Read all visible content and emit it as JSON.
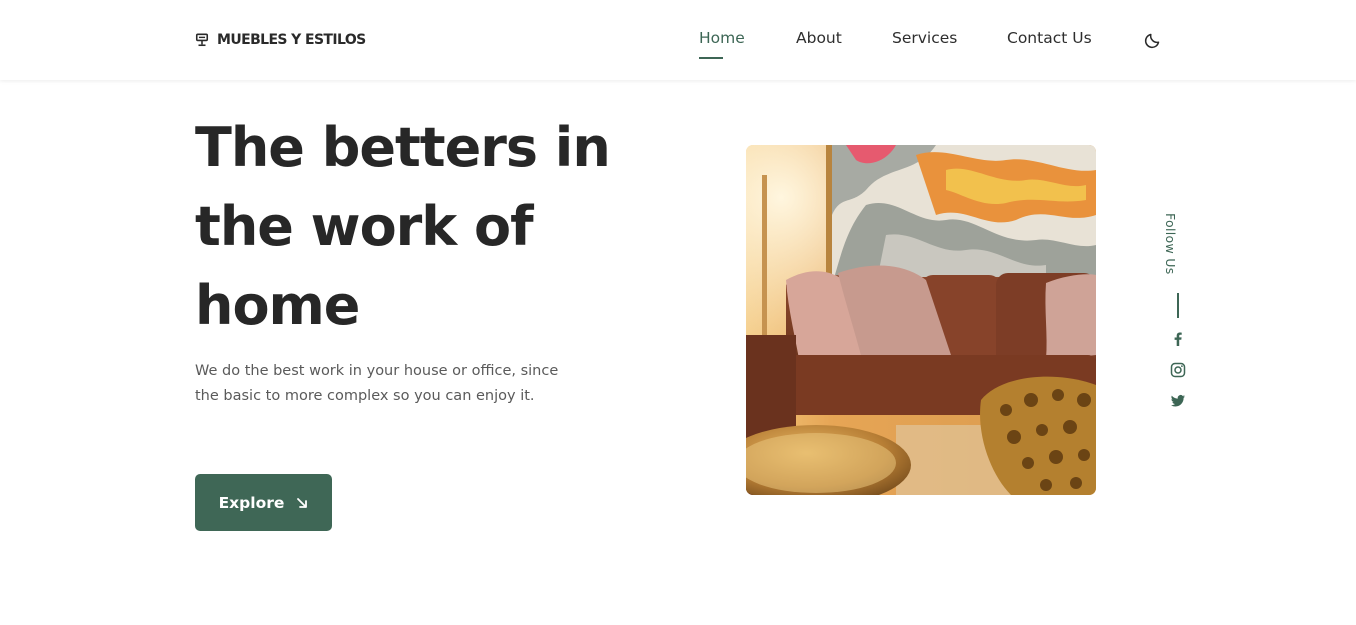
{
  "brand": {
    "name": "MUEBLES Y ESTILOS",
    "icon": "sofa-icon"
  },
  "nav": {
    "items": [
      {
        "label": "Home",
        "active": true
      },
      {
        "label": "About",
        "active": false
      },
      {
        "label": "Services",
        "active": false
      },
      {
        "label": "Contact Us",
        "active": false
      }
    ],
    "theme_toggle_icon": "moon-icon"
  },
  "hero": {
    "title": "The betters in the work of home",
    "description": "We do the best work in your house or office, since the basic to more complex so you can enjoy it.",
    "button_label": "Explore",
    "button_icon": "arrow-down-right-icon",
    "image_alt": "living room with leather sofa, cushions and abstract painting"
  },
  "social": {
    "label": "Follow Us",
    "links": [
      {
        "icon": "facebook-icon"
      },
      {
        "icon": "instagram-icon"
      },
      {
        "icon": "twitter-icon"
      }
    ]
  },
  "colors": {
    "accent": "#3f6756",
    "text": "#272727",
    "muted": "#5a5a5a"
  }
}
